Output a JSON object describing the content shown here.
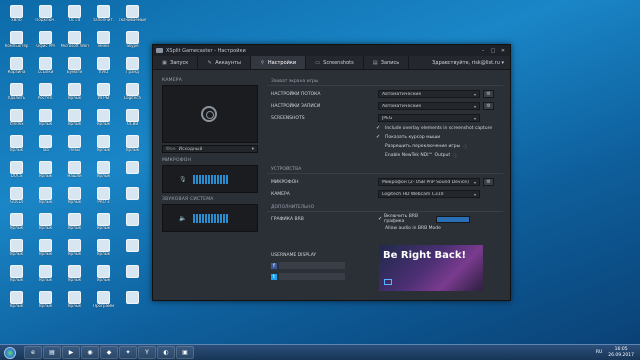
{
  "window": {
    "title": "XSplit Gamecaster - Настройки",
    "minimize": "–",
    "maximize": "□",
    "close": "✕"
  },
  "menu": {
    "tabs": [
      {
        "label": "Запуск",
        "icon": "gamepad-icon"
      },
      {
        "label": "Аккаунты",
        "icon": "wrench-icon"
      },
      {
        "label": "Настройки",
        "icon": "search-icon"
      },
      {
        "label": "Screenshots",
        "icon": "screen-icon"
      },
      {
        "label": "Запись",
        "icon": "record-icon"
      }
    ],
    "greeting": "Здравствуйте, risk@list.ru ▾"
  },
  "left": {
    "camera_header": "КАМЕРА",
    "background_label": "Фон",
    "background_value": "Исходный",
    "mic_header": "МИКРОФОН",
    "system_header": "ЗВУКОВАЯ СИСТЕМА"
  },
  "capture": {
    "header": "Захват экрана игры",
    "rows": [
      {
        "label": "НАСТРОЙКИ ПОТОКА",
        "value": "Автоматические"
      },
      {
        "label": "НАСТРОЙКИ ЗАПИСИ",
        "value": "Автоматические"
      },
      {
        "label": "SCREENSHOTS",
        "value": "JPEG"
      }
    ],
    "checks": [
      "Include overlay elements in screenshot capture",
      "Показать курсор мыши",
      "Разрешить переключение игры",
      "Enable NewTek NDI™ Output"
    ]
  },
  "devices": {
    "header": "УСТРОЙСТВА",
    "rows": [
      {
        "label": "МИКРОФОН",
        "value": "Микрофон (2- USB PnP Sound Device)"
      },
      {
        "label": "КАМЕРА",
        "value": "Logitech HD Webcam C310"
      }
    ]
  },
  "extra": {
    "header": "ДОПОЛНИТЕЛЬНО",
    "brb_label": "ГРАФИКА BRB",
    "brb_enable": "Включить BRB графика",
    "brb_allow": "Allow audio in BRB Mode",
    "brb_heading": "Be Right Back!",
    "username_label": "USERNAME DISPLAY"
  },
  "desktop_icons": [
    "xBrib",
    "Подключ.",
    "Ос cd",
    "заполнит.",
    "скачиваемые",
    "Компьютер",
    "Офис PM",
    "Microsoft Word",
    "мини",
    "Skype",
    "Корзина",
    "Ссылки",
    "Бумаги",
    "XVID",
    "Гранд",
    "Удалить",
    "Ростел.",
    "Ярлык",
    "ИГРЫ",
    "Logitech",
    "Yandex",
    "Ярлык",
    "Ярлык",
    "Ярлык",
    "UCBB",
    "Ярлык",
    "Tab",
    "Лёвы",
    "Ярлык",
    "Ярлык",
    "DOCS",
    "Ярлык",
    "Нашли",
    "Ярлык",
    "",
    "GOLDI",
    "Ярлык",
    "Ярлык",
    "PRO 3",
    "",
    "Ярлык",
    "Ярлык",
    "Ярлык",
    "Ярлык",
    "",
    "Ярлык",
    "Ярлык",
    "Ярлык",
    "Ярлык",
    "",
    "Ярлык",
    "Ярлык",
    "Ярлык",
    "Ярлык",
    "",
    "Ярлык",
    "Ярлык",
    "Ярлык",
    "Программ",
    ""
  ],
  "taskbar": {
    "lang": "RU",
    "time": "16:05",
    "date": "26.09.2017"
  }
}
